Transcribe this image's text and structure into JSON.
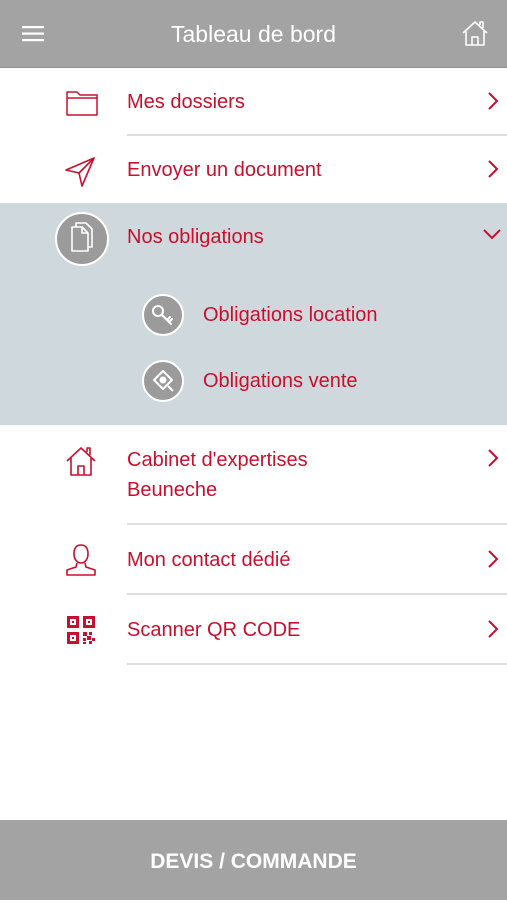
{
  "header": {
    "title": "Tableau de bord",
    "menu_icon": "hamburger-menu-icon",
    "home_icon": "home-icon"
  },
  "menu": {
    "items": [
      {
        "label": "Mes dossiers",
        "icon": "folder-icon"
      },
      {
        "label": "Envoyer un document",
        "icon": "paper-plane-icon"
      },
      {
        "label": "Nos obligations",
        "icon": "documents-icon",
        "expanded": true
      },
      {
        "label_line1": "Cabinet d'expertises",
        "label_line2": "Beuneche",
        "icon": "house-icon"
      },
      {
        "label": "Mon contact dédié",
        "icon": "person-icon"
      },
      {
        "label": "Scanner QR CODE",
        "icon": "qr-code-icon"
      }
    ],
    "subitems": [
      {
        "label": "Obligations location",
        "icon": "key-icon"
      },
      {
        "label": "Obligations vente",
        "icon": "tag-icon"
      }
    ]
  },
  "footer": {
    "label": "DEVIS / COMMANDE"
  },
  "colors": {
    "accent": "#c8102e",
    "header_bg": "#a3a3a3",
    "expanded_bg": "#cfd8dc",
    "separator": "#dedede"
  }
}
